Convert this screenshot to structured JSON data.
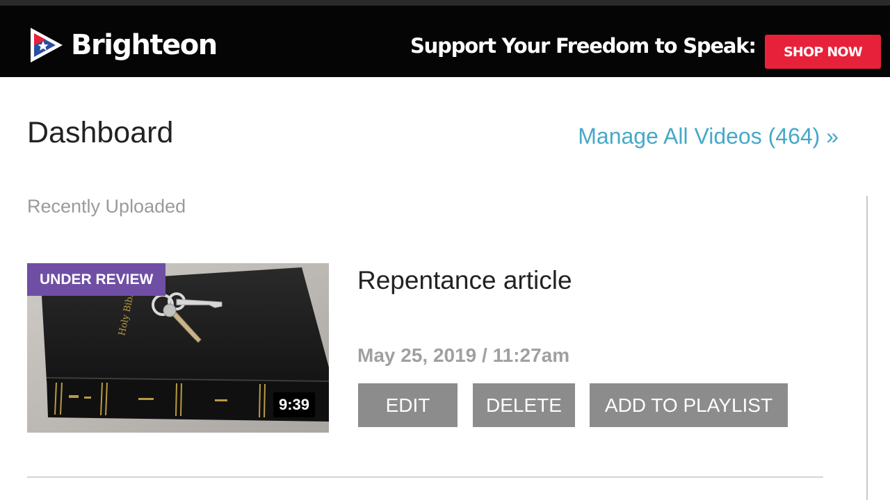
{
  "header": {
    "brand": "Brighteon",
    "support_text": "Support Your Freedom to Speak:",
    "shop_button": "SHOP NOW",
    "shop_color": "#e8213a"
  },
  "dashboard": {
    "title": "Dashboard",
    "manage_link": "Manage All Videos (464) »",
    "link_color": "#45a9c9",
    "section_label": "Recently Uploaded"
  },
  "videos": [
    {
      "status_badge": "UNDER REVIEW",
      "badge_color": "#6f4fa4",
      "duration": "9:39",
      "title": "Repentance article",
      "date": "May 25, 2019 / 11:27am",
      "actions": {
        "edit": "EDIT",
        "delete": "DELETE",
        "add_to_playlist": "ADD TO PLAYLIST"
      }
    }
  ],
  "icons": {
    "logo": "brighteon-logo-icon"
  }
}
